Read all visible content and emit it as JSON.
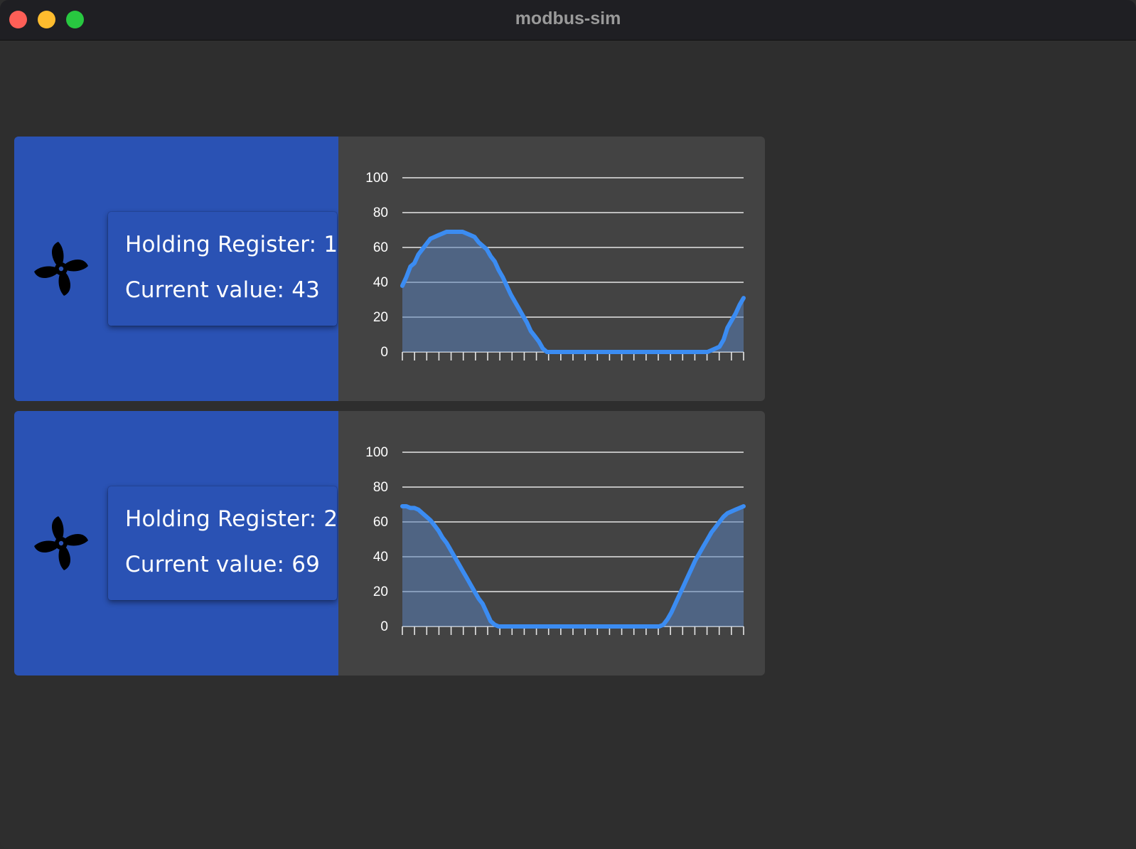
{
  "window": {
    "title": "modbus-sim"
  },
  "registers": [
    {
      "label": "Holding Register: 1",
      "value_label": "Current value: 43",
      "icon": "fan-icon"
    },
    {
      "label": "Holding Register: 2",
      "value_label": "Current value: 69",
      "icon": "fan-icon"
    }
  ],
  "chart_data": [
    {
      "type": "area",
      "ylim": [
        0,
        100
      ],
      "yticks": [
        0,
        20,
        40,
        60,
        80,
        100
      ],
      "grid": true,
      "line_color": "#3b8cf2",
      "values": [
        38,
        43,
        49,
        51,
        56,
        59,
        62,
        65,
        66,
        67,
        68,
        69,
        69,
        69,
        69,
        69,
        68,
        67,
        66,
        63,
        61,
        59,
        55,
        52,
        47,
        43,
        38,
        33,
        29,
        25,
        21,
        17,
        12,
        9,
        6,
        2,
        0,
        0,
        0,
        0,
        0,
        0,
        0,
        0,
        0,
        0,
        0,
        0,
        0,
        0,
        0,
        0,
        0,
        0,
        0,
        0,
        0,
        0,
        0,
        0,
        0,
        0,
        0,
        0,
        0,
        0,
        0,
        0,
        0,
        0,
        0,
        0,
        0,
        0,
        0,
        0,
        0,
        1,
        2,
        3,
        7,
        14,
        18,
        22,
        27,
        31
      ]
    },
    {
      "type": "area",
      "ylim": [
        0,
        100
      ],
      "yticks": [
        0,
        20,
        40,
        60,
        80,
        100
      ],
      "grid": true,
      "line_color": "#3b8cf2",
      "values": [
        69,
        69,
        68,
        68,
        67,
        65,
        63,
        61,
        58,
        55,
        51,
        48,
        44,
        40,
        36,
        32,
        28,
        24,
        20,
        16,
        13,
        8,
        3,
        1,
        0,
        0,
        0,
        0,
        0,
        0,
        0,
        0,
        0,
        0,
        0,
        0,
        0,
        0,
        0,
        0,
        0,
        0,
        0,
        0,
        0,
        0,
        0,
        0,
        0,
        0,
        0,
        0,
        0,
        0,
        0,
        0,
        0,
        0,
        0,
        0,
        0,
        0,
        0,
        0,
        0,
        1,
        4,
        8,
        13,
        18,
        23,
        28,
        33,
        38,
        42,
        46,
        50,
        54,
        57,
        60,
        63,
        65,
        66,
        67,
        68,
        69
      ]
    }
  ]
}
